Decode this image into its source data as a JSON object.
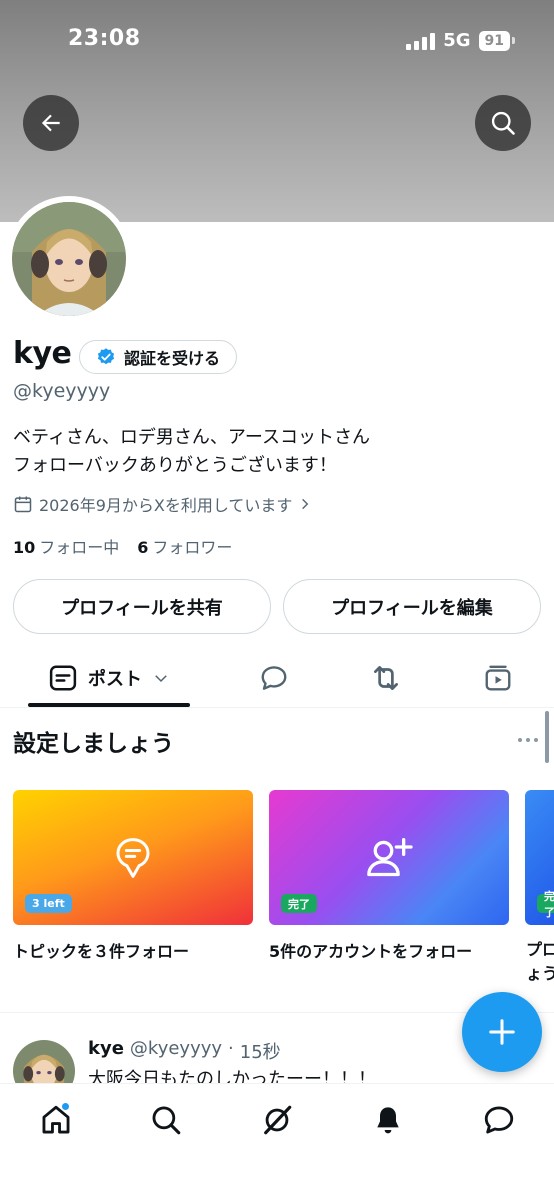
{
  "status_bar": {
    "time": "23:08",
    "network": "5G",
    "battery": "91"
  },
  "profile": {
    "name": "kye",
    "verify_label": "認証を受ける",
    "handle": "@kyeyyyy",
    "bio_line1": "ベティさん、ロデ男さん、アースコットさん",
    "bio_line2": "フォローバックありがとうございます！",
    "joined": "2026年9月からXを利用しています",
    "following_count": "10",
    "following_label": "フォロー中",
    "followers_count": "6",
    "followers_label": "フォロワー",
    "share_label": "プロフィールを共有",
    "edit_label": "プロフィールを編集"
  },
  "tabs": {
    "posts_label": "ポスト"
  },
  "setup": {
    "title": "設定しましょう",
    "cards": [
      {
        "badge": "3 left",
        "label": "トピックを３件フォロー"
      },
      {
        "badge": "完了",
        "label": "5件のアカウントをフォロー"
      },
      {
        "badge": "完了",
        "label": "プロ ょう"
      }
    ]
  },
  "post": {
    "name": "kye",
    "handle": "@kyeyyyy",
    "time": "15秒",
    "text": "大阪今日もたのしかったーー！！！"
  },
  "colors": {
    "accent": "#1d9bf0",
    "secondary_text": "#536471"
  }
}
